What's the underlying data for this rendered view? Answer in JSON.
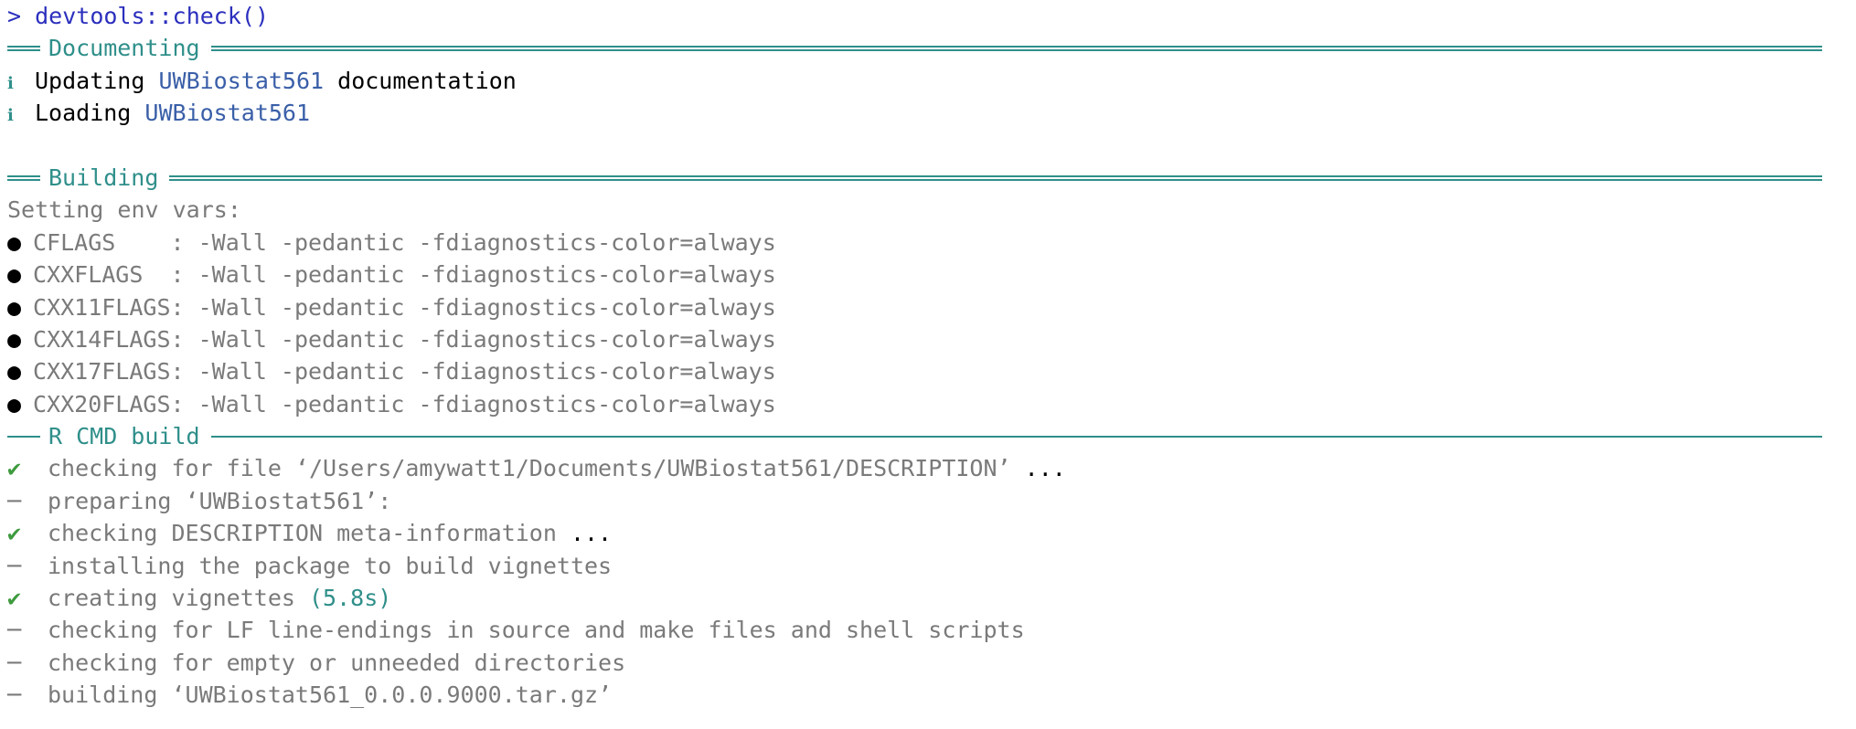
{
  "prompt": {
    "marker": ">",
    "command": "devtools::check()"
  },
  "sections": {
    "documenting": {
      "title": "Documenting",
      "messages": [
        {
          "prefix": "Updating ",
          "pkg": "UWBiostat561",
          "suffix": " documentation"
        },
        {
          "prefix": "Loading ",
          "pkg": "UWBiostat561",
          "suffix": ""
        }
      ]
    },
    "building": {
      "title": "Building",
      "env_header": "Setting env vars:",
      "env_vars": [
        {
          "name": "CFLAGS    ",
          "value": ": -Wall -pedantic -fdiagnostics-color=always"
        },
        {
          "name": "CXXFLAGS  ",
          "value": ": -Wall -pedantic -fdiagnostics-color=always"
        },
        {
          "name": "CXX11FLAGS",
          "value": ": -Wall -pedantic -fdiagnostics-color=always"
        },
        {
          "name": "CXX14FLAGS",
          "value": ": -Wall -pedantic -fdiagnostics-color=always"
        },
        {
          "name": "CXX17FLAGS",
          "value": ": -Wall -pedantic -fdiagnostics-color=always"
        },
        {
          "name": "CXX20FLAGS",
          "value": ": -Wall -pedantic -fdiagnostics-color=always"
        }
      ]
    },
    "rcmd": {
      "title": "R CMD build",
      "steps": [
        {
          "status": "check",
          "text": "checking for file ‘/Users/amywatt1/Documents/UWBiostat561/DESCRIPTION’",
          "extra": " ...",
          "timing": ""
        },
        {
          "status": "dash",
          "text": "preparing ‘UWBiostat561’:",
          "extra": "",
          "timing": ""
        },
        {
          "status": "check",
          "text": "checking DESCRIPTION meta-information",
          "extra": " ...",
          "timing": ""
        },
        {
          "status": "dash",
          "text": "installing the package to build vignettes",
          "extra": "",
          "timing": ""
        },
        {
          "status": "check",
          "text": "creating vignettes",
          "extra": "",
          "timing": " (5.8s)"
        },
        {
          "status": "dash",
          "text": "checking for LF line-endings in source and make files and shell scripts",
          "extra": "",
          "timing": ""
        },
        {
          "status": "dash",
          "text": "checking for empty or unneeded directories",
          "extra": "",
          "timing": ""
        },
        {
          "status": "dash",
          "text": "building ‘UWBiostat561_0.0.0.9000.tar.gz’",
          "extra": "",
          "timing": ""
        }
      ]
    }
  },
  "icons": {
    "info": "ℹ",
    "bullet": "●",
    "check": "✔",
    "dash": "─"
  },
  "colors": {
    "command": "#2b2fbd",
    "rule": "#2f8f8a",
    "package": "#3a5fa8",
    "muted": "#7a7a7a",
    "success": "#3e9b3e"
  }
}
